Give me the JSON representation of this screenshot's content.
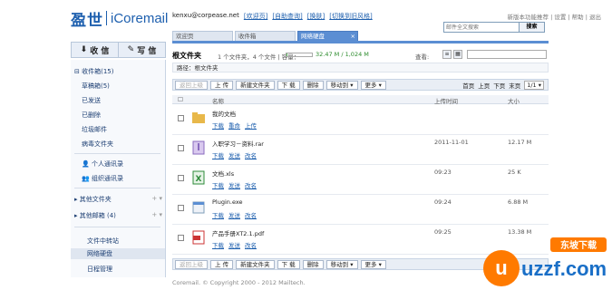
{
  "brand": {
    "name_cn": "盈世",
    "name_en": "iCoremail"
  },
  "user": {
    "email": "kenxu@corpease.net",
    "links": [
      "[欢迎页]",
      "[自助查询]",
      "[换肤]",
      "[切换到旧风格]"
    ]
  },
  "top_links": "新版本功能推荐 | 设置 | 帮助 | 退出",
  "search": {
    "placeholder": "邮件全文搜索",
    "button": "搜索"
  },
  "tabs": [
    {
      "label": "欢迎页"
    },
    {
      "label": "收件箱"
    },
    {
      "label": "网络硬盘",
      "active": true
    }
  ],
  "sidebar": {
    "receive": "收 信",
    "write": "写 信",
    "items": [
      {
        "label": "收件箱(15)"
      },
      {
        "label": "草稿箱(5)"
      },
      {
        "label": "已发送"
      },
      {
        "label": "已删除"
      },
      {
        "label": "垃圾邮件"
      },
      {
        "label": "病毒文件夹"
      },
      {
        "label": "个人通讯录"
      },
      {
        "label": "组织通讯录"
      },
      {
        "label": "其他文件夹"
      },
      {
        "label": "其他邮箱 (4)"
      },
      {
        "label": "文件中转站"
      },
      {
        "label": "网络硬盘"
      },
      {
        "label": "日程管理"
      }
    ]
  },
  "main": {
    "title": "根文件夹",
    "info": "1 个文件夹，4 个文件 | 容量：",
    "quota_text": "32.47 M / 1,024 M",
    "quota_fraction": 0.032,
    "view_label": "查看:",
    "path": "路径：根文件夹",
    "toolbar": {
      "up": "返回上级",
      "upload": "上 传",
      "newfolder": "新建文件夹",
      "download": "下 载",
      "delete": "删除",
      "move": "移动到 ▾",
      "more": "更多 ▾"
    },
    "pager": {
      "first": "首页",
      "prev": "上页",
      "next": "下页",
      "last": "末页",
      "page": "1/1 ▾"
    },
    "columns": {
      "name": "名称",
      "date": "上传时间",
      "size": "大小"
    },
    "rows": [
      {
        "name": "我的文档",
        "date": "",
        "size": "",
        "icon": "folder-icon",
        "actions": [
          "下载",
          "重命",
          "上传"
        ]
      },
      {
        "name": "入职学习－资料.rar",
        "date": "2011-11-01",
        "size": "12.17 M",
        "icon": "archive-icon",
        "actions": [
          "下载",
          "发送",
          "改名"
        ]
      },
      {
        "name": "文档.xls",
        "date": "09:23",
        "size": "25 K",
        "icon": "excel-icon",
        "actions": [
          "下载",
          "发送",
          "改名"
        ]
      },
      {
        "name": "Plugin.exe",
        "date": "09:24",
        "size": "6.88 M",
        "icon": "exe-icon",
        "actions": [
          "下载",
          "发送",
          "改名"
        ]
      },
      {
        "name": "产品手册XT2.1.pdf",
        "date": "09:25",
        "size": "13.38 M",
        "icon": "pdf-icon",
        "actions": [
          "下载",
          "发送",
          "改名"
        ]
      }
    ]
  },
  "footer": "Coremail. © Copyright 2000 - 2012 Mailtech.",
  "watermark": {
    "text_top": "东坡下载",
    "text_main": "uzzf.com"
  }
}
